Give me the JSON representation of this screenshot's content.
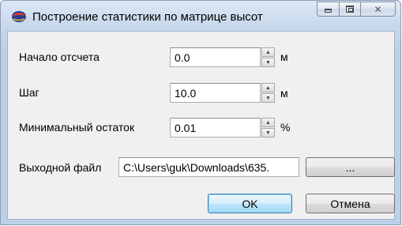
{
  "window": {
    "title": "Построение статистики по матрице высот",
    "caption": {
      "minimize": "▭",
      "maximize": "▣",
      "close": "✕"
    }
  },
  "form": {
    "origin": {
      "label": "Начало отсчета",
      "value": "0.0",
      "unit": "м"
    },
    "step": {
      "label": "Шаг",
      "value": "10.0",
      "unit": "м"
    },
    "min_remainder": {
      "label": "Минимальный остаток",
      "value": "0.01",
      "unit": "%"
    },
    "output_file": {
      "label": "Выходной файл",
      "value": "C:\\Users\\guk\\Downloads\\635.",
      "browse_label": "..."
    }
  },
  "buttons": {
    "ok": "OK",
    "cancel": "Отмена"
  },
  "colors": {
    "accent": "#3c7fb1",
    "client_bg": "#f0f0f0",
    "frame": "#c9d9ec"
  },
  "icons": [
    "app-icon",
    "spin-up-icon",
    "spin-down-icon"
  ]
}
